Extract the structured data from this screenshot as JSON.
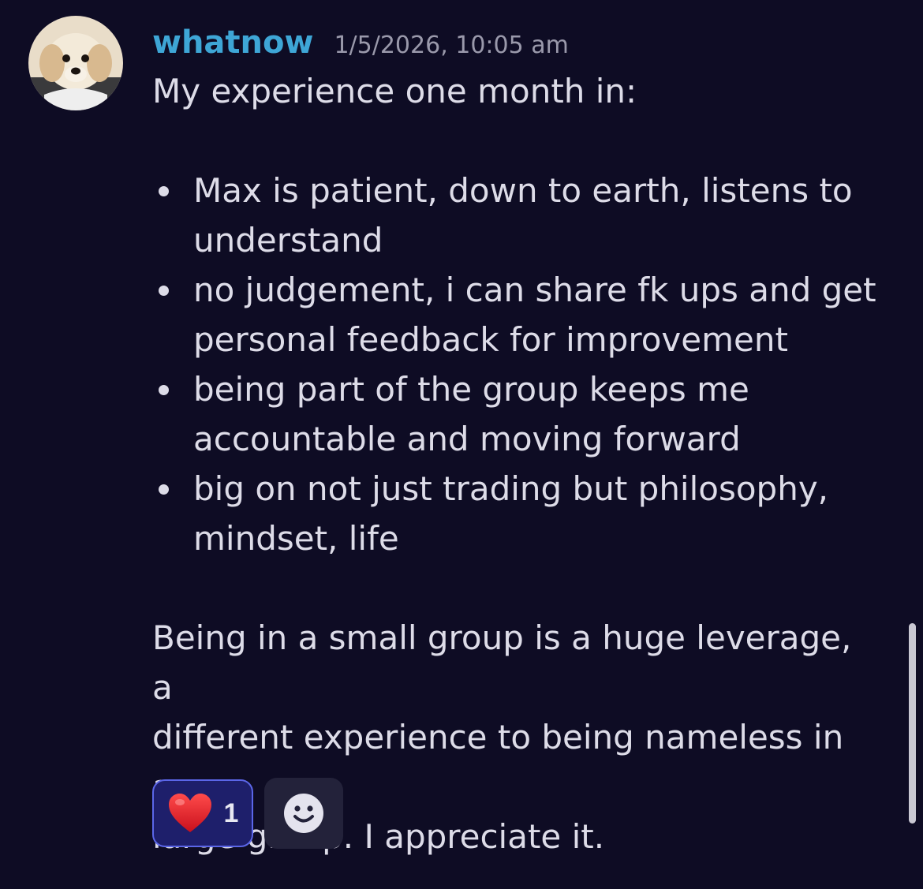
{
  "message": {
    "username": "whatnow",
    "timestamp": "1/5/2026, 10:05 am",
    "avatar_icon": "dog-avatar",
    "intro": "My experience one month in:",
    "bullets": [
      [
        "Max is patient, down to earth, listens to",
        "understand"
      ],
      [
        "no judgement, i can share fk ups and get",
        "personal feedback for improvement"
      ],
      [
        "being part of the group keeps me",
        "accountable and moving forward"
      ],
      [
        "big on not just trading but philosophy,",
        "mindset, life"
      ]
    ],
    "closing": [
      "Being in a small group is a huge leverage, a",
      "different experience to being nameless in a",
      "large group.  I appreciate it."
    ]
  },
  "reactions": [
    {
      "emoji_icon": "red-heart-icon",
      "count": "1"
    }
  ],
  "add_reaction_icon": "smiley-icon",
  "colors": {
    "background": "#0e0c24",
    "username": "#3ea6d6",
    "text": "#dddce8",
    "timestamp": "#9a99ab",
    "reaction_border": "#5b66e8",
    "reaction_bg": "#1e1f6b"
  }
}
